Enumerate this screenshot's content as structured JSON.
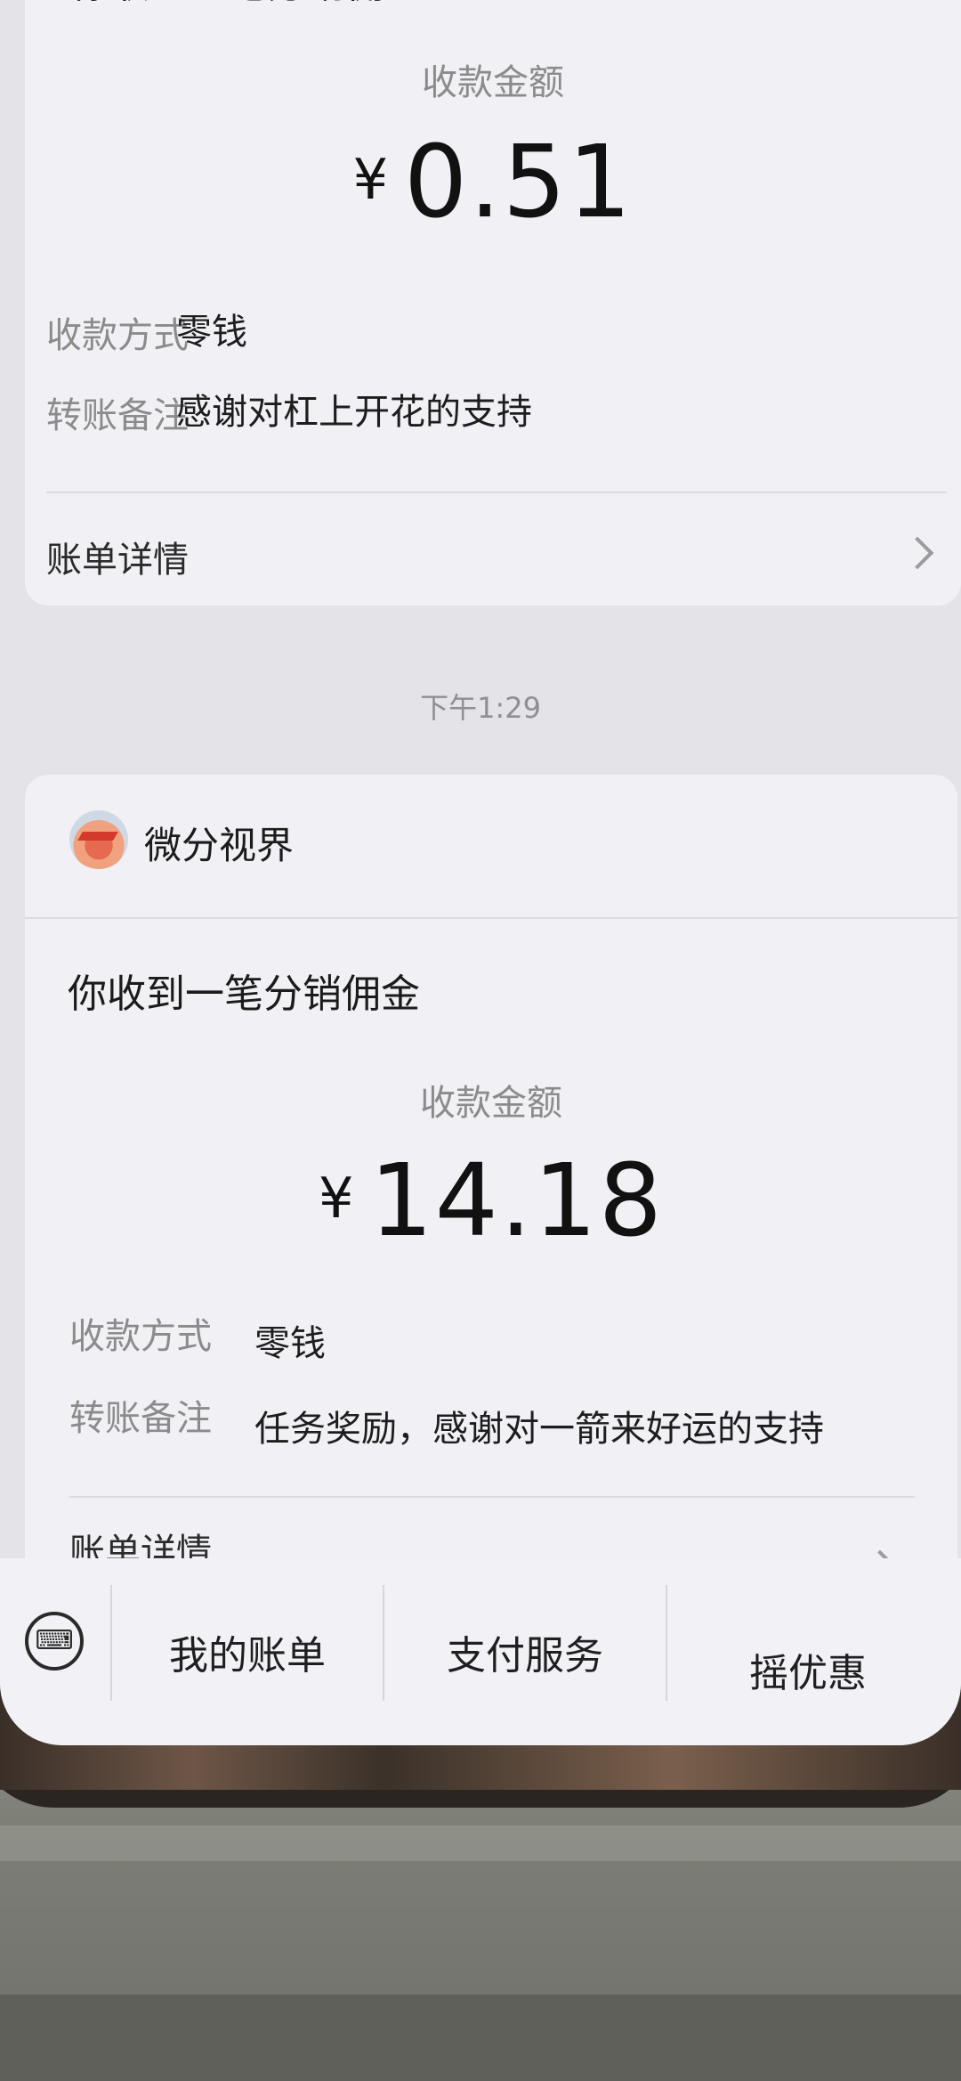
{
  "messages": [
    {
      "title": "你收到一笔分销佣金",
      "amount_label": "收款金额",
      "currency": "¥",
      "amount": "0.51",
      "rows": [
        {
          "key": "收款方式",
          "value": "零钱"
        },
        {
          "key": "转账备注",
          "value": "感谢对杠上开花的支持"
        }
      ],
      "detail_label": "账单详情"
    },
    {
      "merchant": "微分视界",
      "title": "你收到一笔分销佣金",
      "amount_label": "收款金额",
      "currency": "¥",
      "amount": "14.18",
      "rows": [
        {
          "key": "收款方式",
          "value": "零钱"
        },
        {
          "key": "转账备注",
          "value": "任务奖励，感谢对一箭来好运的支持"
        }
      ],
      "detail_label": "账单详情"
    }
  ],
  "timestamp": "下午1:29",
  "bottom_menu": {
    "keyboard_icon": "keyboard-icon",
    "items": [
      "我的账单",
      "支付服务",
      "摇优惠"
    ]
  }
}
